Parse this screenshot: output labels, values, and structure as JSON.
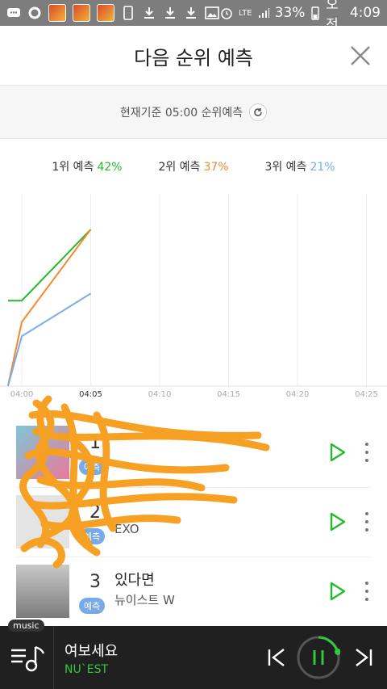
{
  "status_bar": {
    "battery": "33%",
    "network": "LTE",
    "ampm": "오전",
    "time": "4:09"
  },
  "header": {
    "title": "다음 순위 예측"
  },
  "basis": {
    "text": "현재기준 05:00 순위예측"
  },
  "legend": [
    {
      "label": "1위 예측",
      "pct": "42%",
      "color": "#26b92e"
    },
    {
      "label": "2위 예측",
      "pct": "37%",
      "color": "#f28a2c"
    },
    {
      "label": "3위 예측",
      "pct": "21%",
      "color": "#79aee7"
    }
  ],
  "chart_data": {
    "type": "line",
    "x_ticks": [
      "04:00",
      "04:05",
      "04:10",
      "04:15",
      "04:20",
      "04:25"
    ],
    "series": [
      {
        "name": "1위 예측",
        "color": "#26b92e",
        "x": [
          "03:59",
          "04:00",
          "04:05"
        ],
        "y": [
          32,
          32,
          42
        ]
      },
      {
        "name": "2위 예측",
        "color": "#f28a2c",
        "x": [
          "03:59",
          "04:00",
          "04:05"
        ],
        "y": [
          20,
          29,
          42
        ]
      },
      {
        "name": "3위 예측",
        "color": "#79aee7",
        "x": [
          "03:59",
          "04:00",
          "04:05"
        ],
        "y": [
          20,
          27,
          33
        ]
      }
    ],
    "ylim": [
      20,
      47
    ],
    "grid": true
  },
  "rows": [
    {
      "rank": "1",
      "song": "",
      "artist": "",
      "badge": "예측"
    },
    {
      "rank": "2",
      "song": "",
      "artist": "EXO",
      "badge": "예측"
    },
    {
      "rank": "3",
      "song": "있다면",
      "artist": "뉴이스트 W",
      "badge": "예측"
    }
  ],
  "player": {
    "tag": "music",
    "song": "여보세요",
    "artist": "NU`EST"
  }
}
